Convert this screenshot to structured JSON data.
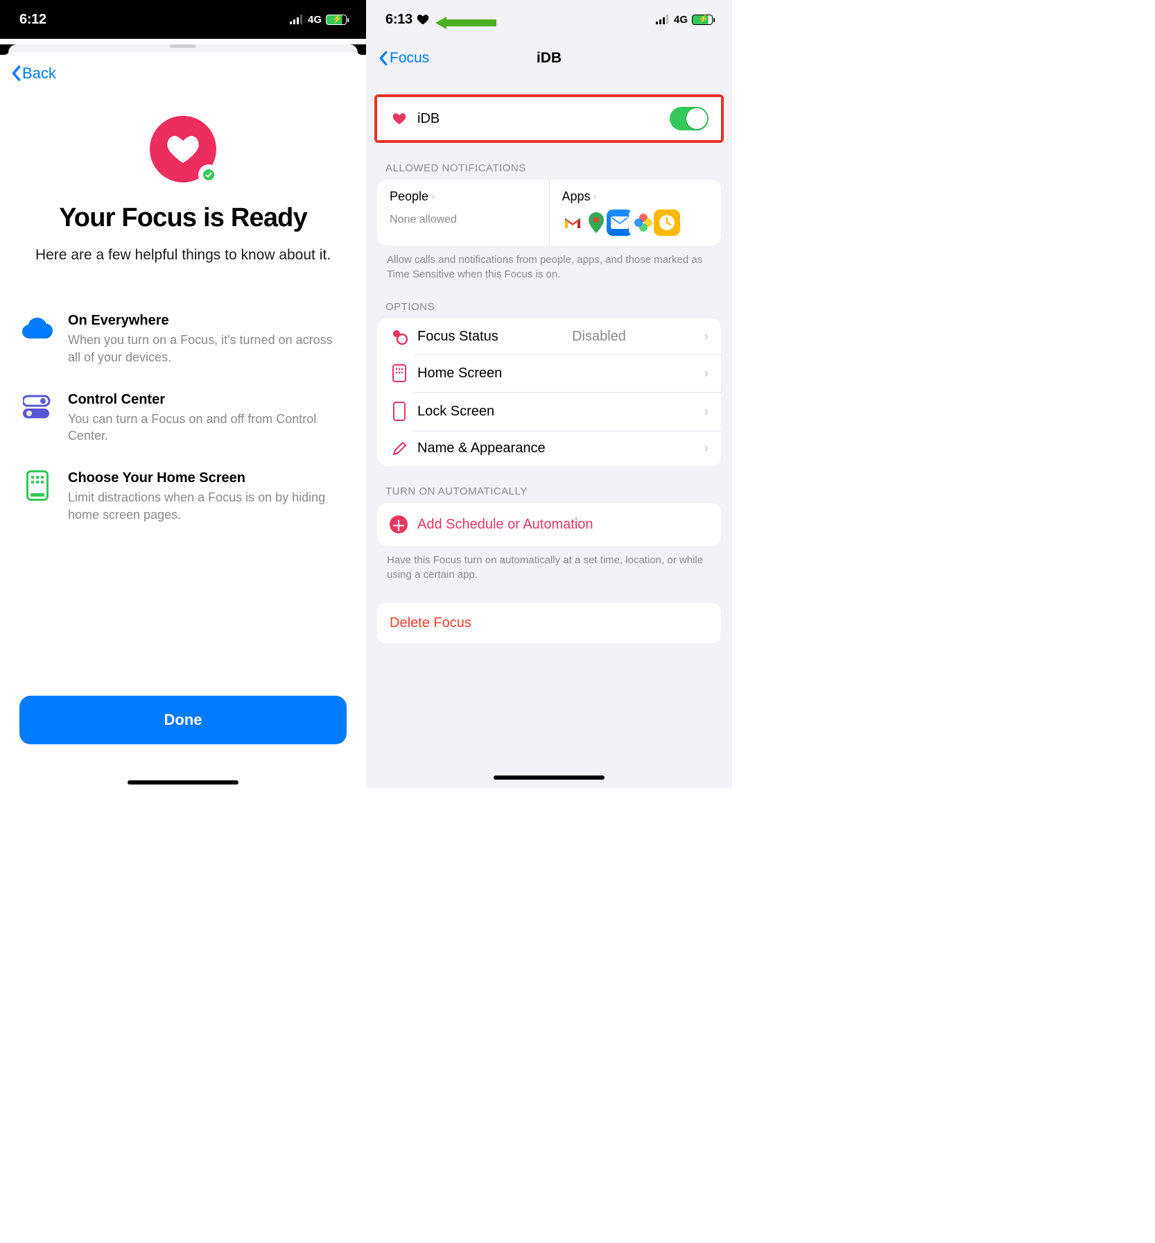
{
  "left": {
    "status": {
      "time": "6:12",
      "network": "4G"
    },
    "back_label": "Back",
    "hero_title": "Your Focus is Ready",
    "hero_subtitle": "Here are a few helpful things to know about it.",
    "features": [
      {
        "title": "On Everywhere",
        "desc": "When you turn on a Focus, it's turned on across all of your devices."
      },
      {
        "title": "Control Center",
        "desc": "You can turn a Focus on and off from Control Center."
      },
      {
        "title": "Choose Your Home Screen",
        "desc": "Limit distractions when a Focus is on by hiding home screen pages."
      }
    ],
    "done_label": "Done"
  },
  "right": {
    "status": {
      "time": "6:13",
      "network": "4G"
    },
    "nav_back": "Focus",
    "nav_title": "iDB",
    "toggle": {
      "label": "iDB",
      "on": true
    },
    "allowed_header": "ALLOWED NOTIFICATIONS",
    "people_title": "People",
    "people_sub": "None allowed",
    "apps_title": "Apps",
    "allowed_footer": "Allow calls and notifications from people, apps, and those marked as Time Sensitive when this Focus is on.",
    "options_header": "OPTIONS",
    "options": [
      {
        "label": "Focus Status",
        "value": "Disabled"
      },
      {
        "label": "Home Screen",
        "value": ""
      },
      {
        "label": "Lock Screen",
        "value": ""
      },
      {
        "label": "Name & Appearance",
        "value": ""
      }
    ],
    "auto_header": "TURN ON AUTOMATICALLY",
    "add_label": "Add Schedule or Automation",
    "auto_footer": "Have this Focus turn on automatically at a set time, location, or while using a certain app.",
    "delete_label": "Delete Focus"
  }
}
